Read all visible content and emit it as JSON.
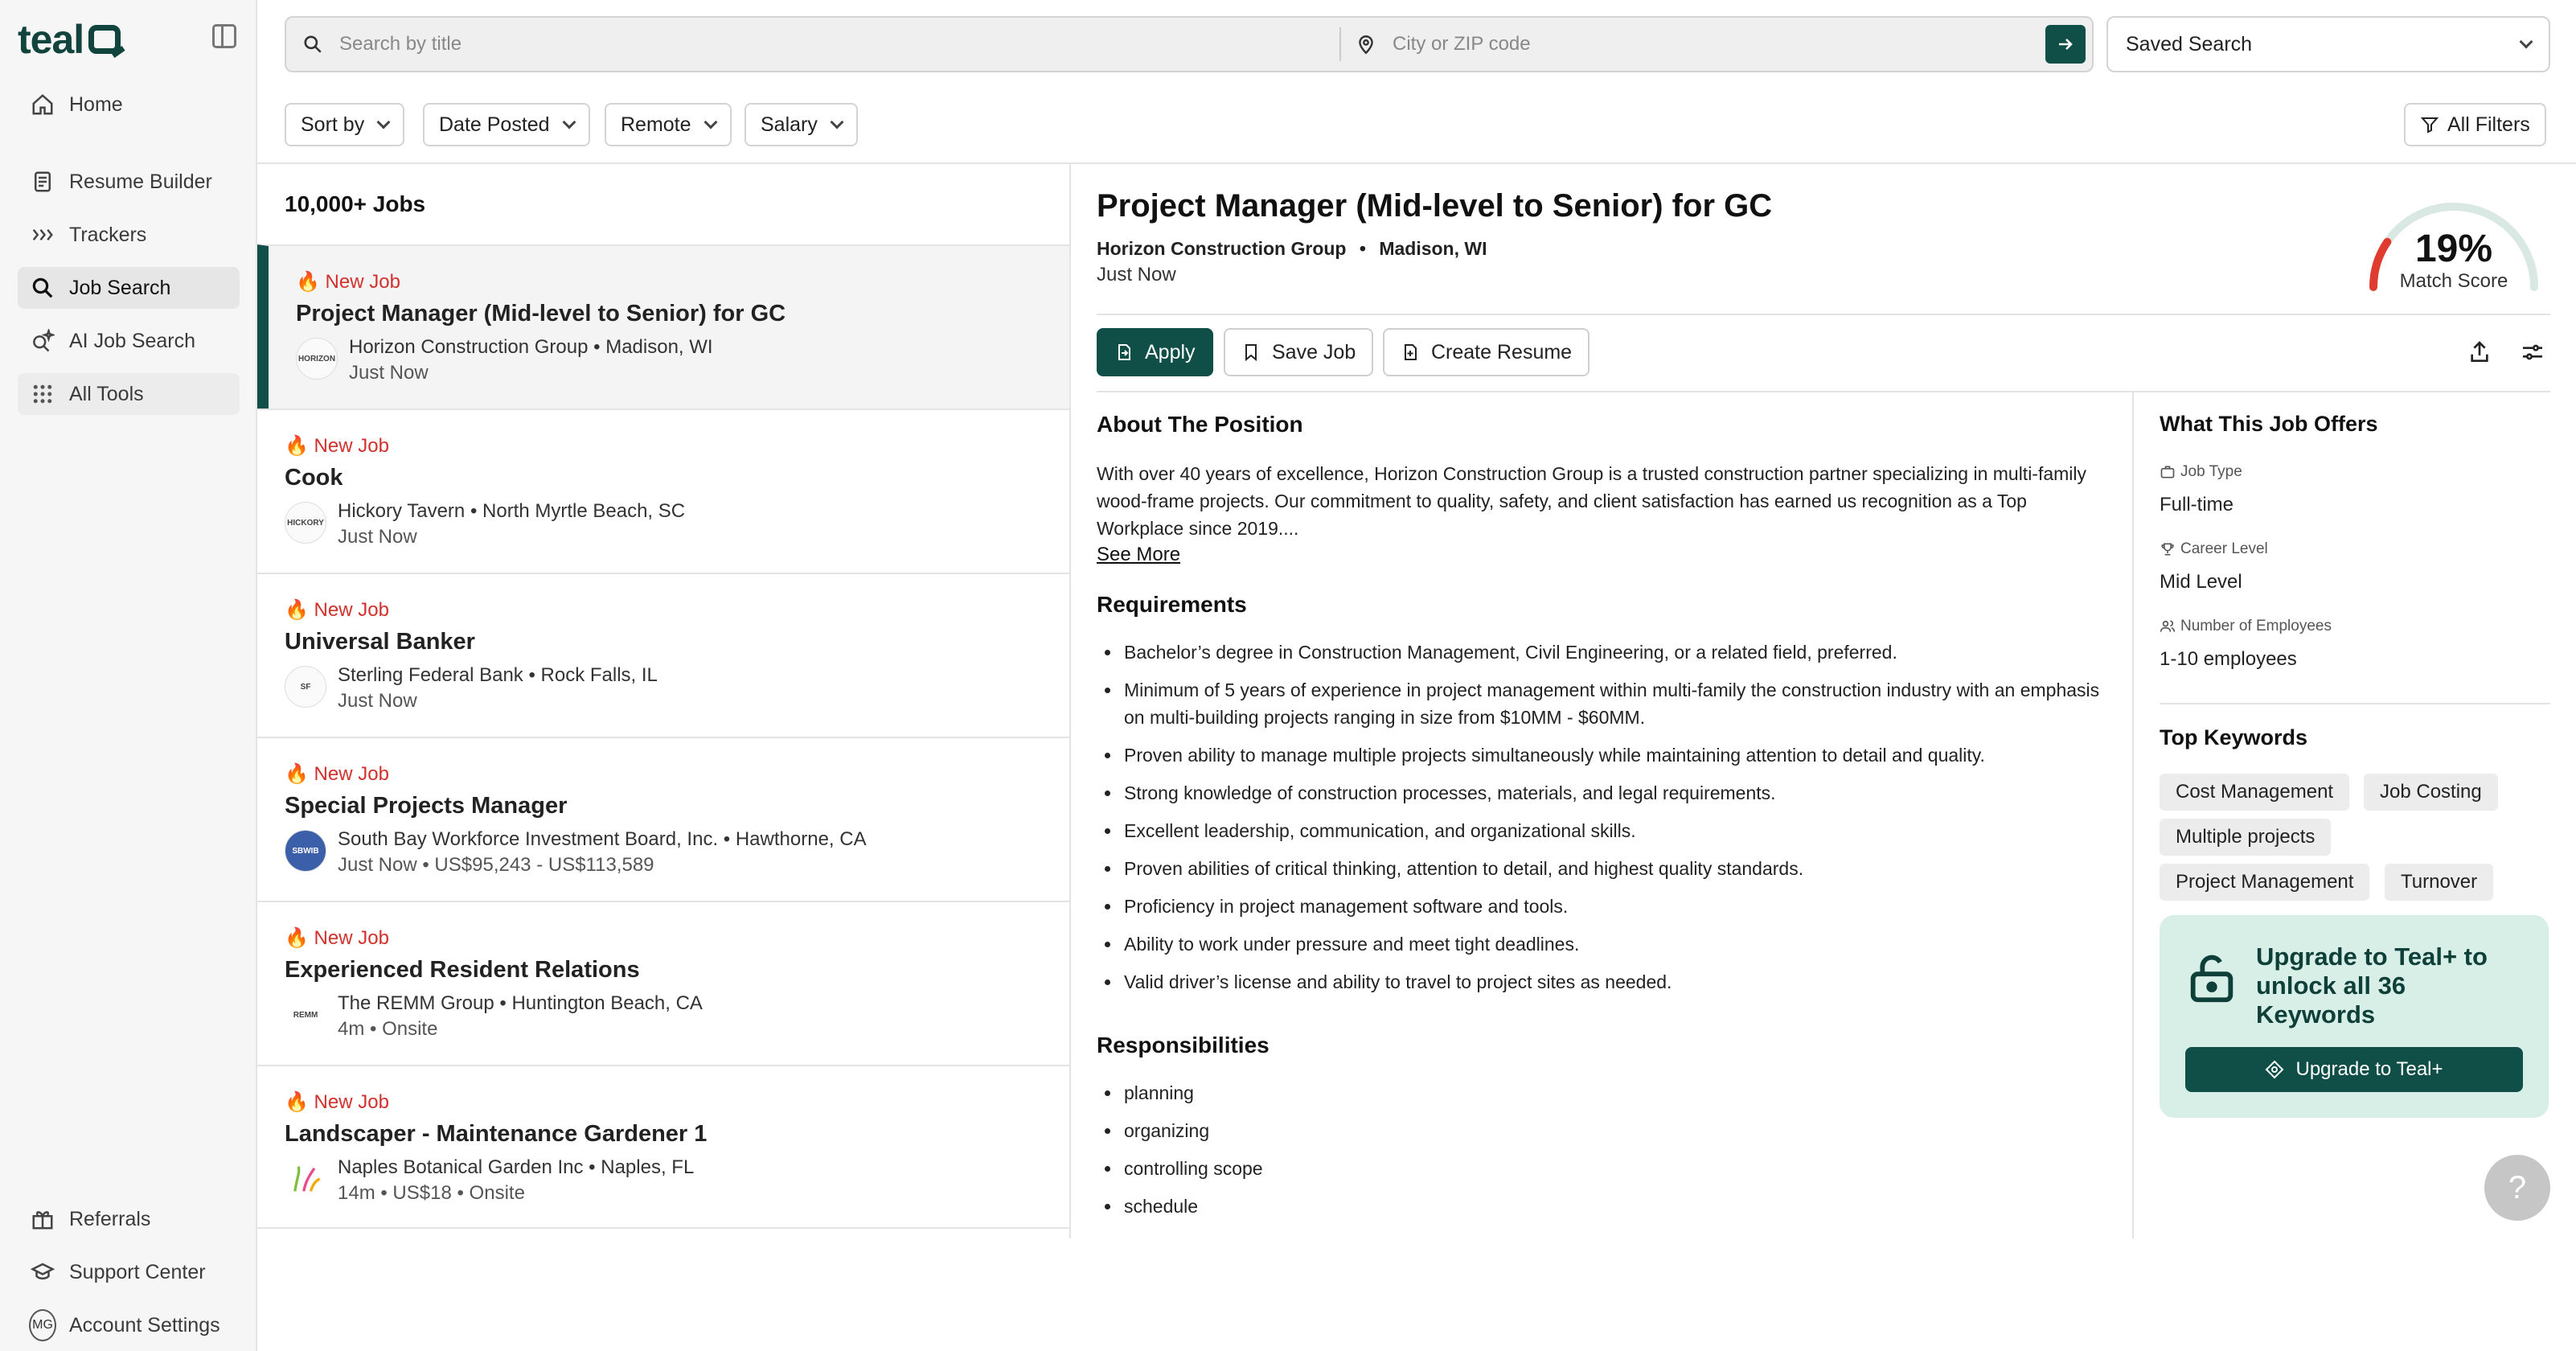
{
  "app": {
    "logo_text": "teal"
  },
  "sidebar": {
    "items": [
      {
        "label": "Home",
        "icon": "home-icon"
      },
      {
        "label": "Resume Builder",
        "icon": "document-icon"
      },
      {
        "label": "Trackers",
        "icon": "chevrons-icon"
      },
      {
        "label": "Job Search",
        "icon": "search-icon"
      },
      {
        "label": "AI Job Search",
        "icon": "ai-search-icon"
      },
      {
        "label": "All Tools",
        "icon": "grid-icon"
      }
    ],
    "bottom_items": [
      {
        "label": "Referrals",
        "icon": "gift-icon"
      },
      {
        "label": "Support Center",
        "icon": "grad-cap-icon"
      },
      {
        "label": "Account Settings",
        "icon": "avatar",
        "avatar_initials": "MG"
      }
    ]
  },
  "search": {
    "title_placeholder": "Search by title",
    "location_placeholder": "City or ZIP code",
    "saved_search_label": "Saved Search"
  },
  "filters": {
    "sort_by": "Sort by",
    "date_posted": "Date Posted",
    "remote": "Remote",
    "salary": "Salary",
    "all_filters": "All Filters"
  },
  "job_list": {
    "count_label": "10,000+ Jobs",
    "jobs": [
      {
        "tag": "🔥 New Job",
        "title": "Project Manager (Mid-level to Senior) for GC",
        "company_line": "Horizon Construction Group • Madison, WI",
        "meta_line": "Just Now",
        "logo_text": "HORIZON"
      },
      {
        "tag": "🔥 New Job",
        "title": "Cook",
        "company_line": "Hickory Tavern • North Myrtle Beach, SC",
        "meta_line": "Just Now",
        "logo_text": "HICKORY"
      },
      {
        "tag": "🔥 New Job",
        "title": "Universal Banker",
        "company_line": "Sterling Federal Bank • Rock Falls, IL",
        "meta_line": "Just Now",
        "logo_text": "SF"
      },
      {
        "tag": "🔥 New Job",
        "title": "Special Projects Manager",
        "company_line": "South Bay Workforce Investment Board, Inc. • Hawthorne, CA",
        "meta_line": "Just Now • US$95,243 - US$113,589",
        "logo_text": "SBWIB"
      },
      {
        "tag": "🔥 New Job",
        "title": "Experienced Resident Relations",
        "company_line": "The REMM Group • Huntington Beach, CA",
        "meta_line": "4m • Onsite",
        "logo_text": "REMM"
      },
      {
        "tag": "🔥 New Job",
        "title": "Landscaper - Maintenance Gardener 1",
        "company_line": "Naples Botanical Garden Inc • Naples, FL",
        "meta_line": "14m • US$18 • Onsite",
        "logo_text": ""
      }
    ]
  },
  "detail": {
    "title": "Project Manager (Mid-level to Senior) for GC",
    "company": "Horizon Construction Group",
    "location": "Madison, WI",
    "posted": "Just Now",
    "match_score_value": "19%",
    "match_score_fraction": 0.19,
    "match_score_label": "Match Score",
    "actions": {
      "apply": "Apply",
      "save": "Save Job",
      "create_resume": "Create Resume"
    },
    "about_heading": "About The Position",
    "about_text": "With over 40 years of excellence, Horizon Construction Group is a trusted construction partner specializing in multi-family wood-frame projects. Our commitment to quality, safety, and client satisfaction has earned us recognition as a Top Workplace since 2019....",
    "see_more": "See More",
    "requirements_heading": "Requirements",
    "requirements": [
      "Bachelor’s degree in Construction Management, Civil Engineering, or a related field, preferred.",
      "Minimum of 5 years of experience in project management within multi-family the construction industry with an emphasis on multi-building projects ranging in size from $10MM - $60MM.",
      "Proven ability to manage multiple projects simultaneously while maintaining attention to detail and quality.",
      "Strong knowledge of construction processes, materials, and legal requirements.",
      "Excellent leadership, communication, and organizational skills.",
      "Proven abilities of critical thinking, attention to detail, and highest quality standards.",
      "Proficiency in project management software and tools.",
      "Ability to work under pressure and meet tight deadlines.",
      "Valid driver’s license and ability to travel to project sites as needed."
    ],
    "responsibilities_heading": "Responsibilities",
    "responsibilities": [
      "planning",
      "organizing",
      "controlling scope",
      "schedule"
    ],
    "offers_heading": "What This Job Offers",
    "offers": {
      "job_type_label": "Job Type",
      "job_type": "Full-time",
      "career_level_label": "Career Level",
      "career_level": "Mid Level",
      "employees_label": "Number of Employees",
      "employees": "1-10 employees"
    },
    "keywords_heading": "Top Keywords",
    "keywords": [
      "Cost Management",
      "Job Costing",
      "Multiple projects",
      "Project Management",
      "Turnover"
    ],
    "upgrade_text": "Upgrade to Teal+ to unlock all 36 Keywords",
    "upgrade_button": "Upgrade to Teal+"
  },
  "help_label": "?",
  "colors": {
    "brand": "#0f4f47",
    "new_tag": "#d0312d",
    "upgrade_bg": "#d8efe7"
  }
}
